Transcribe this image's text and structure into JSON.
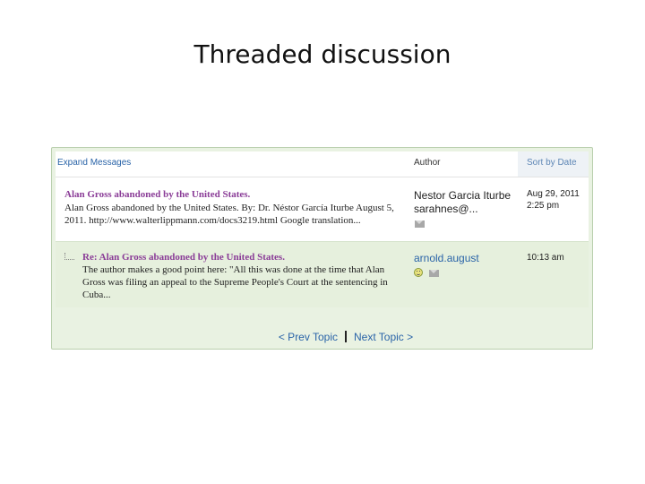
{
  "slide": {
    "title": "Threaded discussion"
  },
  "header": {
    "expand_label": "Expand Messages",
    "author_label": "Author",
    "sort_label": "Sort by Date"
  },
  "messages": [
    {
      "subject": "Alan Gross abandoned by the United States.",
      "excerpt": "Alan Gross abandoned by the United States. By: Dr. Néstor García Iturbe August 5, 2011. http://www.walterlippmann.com/docs3219.html Google translation...",
      "author": "Nestor Garcia Iturbe",
      "email": "sarahnes@...",
      "date": "Aug 29, 2011 2:25 pm"
    },
    {
      "subject": "Re: Alan Gross abandoned by the United States.",
      "excerpt": "The author makes a good point here: \"All this was done at the time that Alan Gross was filing an appeal to the Supreme People's Court at the sentencing in Cuba...",
      "author": "arnold.august",
      "date": "10:13 am"
    }
  ],
  "footer": {
    "prev_label": "< Prev Topic",
    "next_label": "Next Topic >"
  },
  "icons": {
    "mail": "mail-icon",
    "smiley": "smiley-icon",
    "tree": "thread-branch-icon"
  },
  "colors": {
    "subject_link": "#8a3c97",
    "link_blue": "#2a64a8",
    "reply_bg": "#e6f0dd",
    "panel_border": "#b9cfae"
  }
}
